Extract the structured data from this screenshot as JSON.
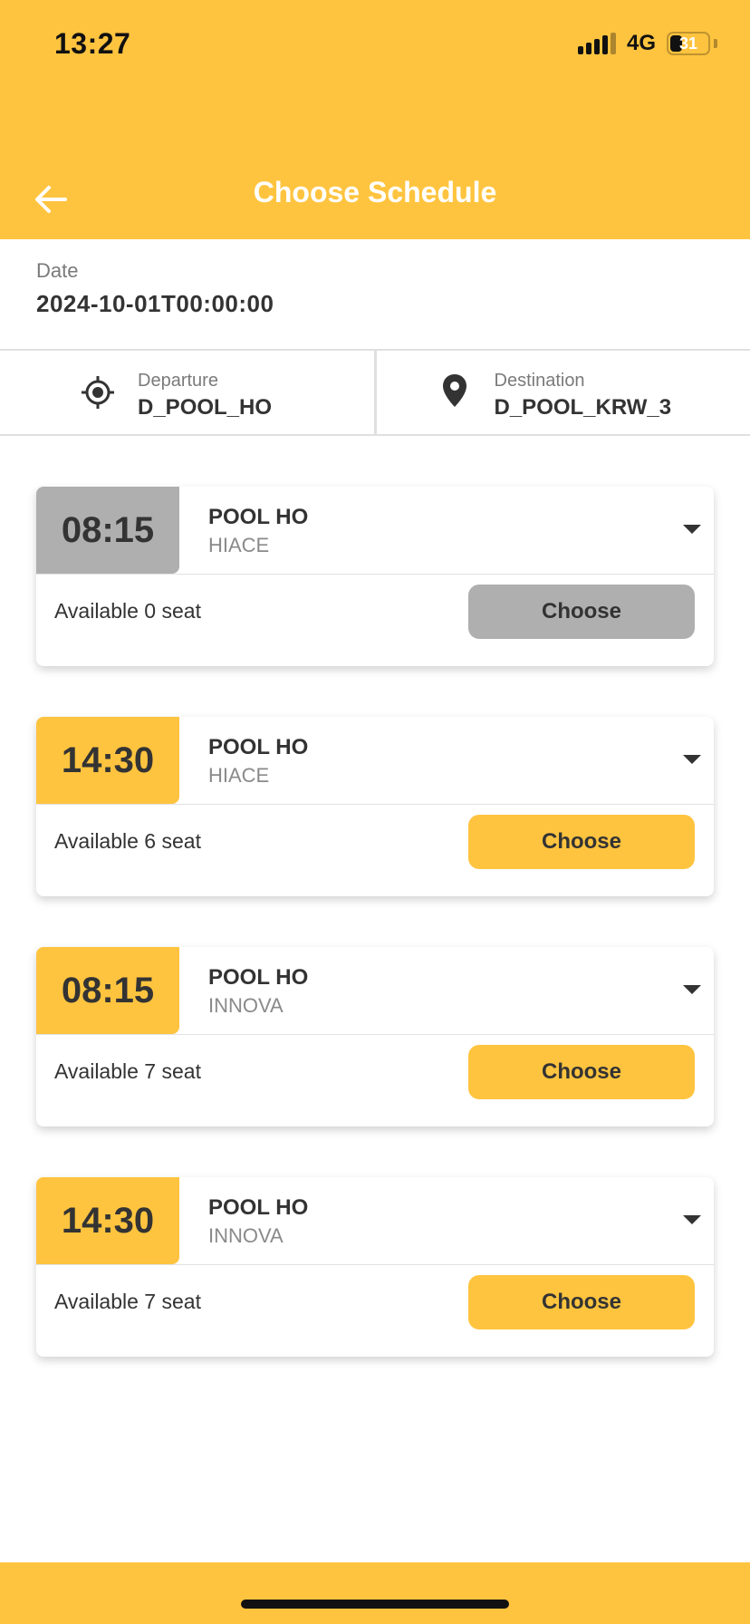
{
  "status_bar": {
    "time": "13:27",
    "network": "4G",
    "battery": "31"
  },
  "header": {
    "title": "Choose Schedule",
    "back_icon": "arrow-left-icon"
  },
  "date": {
    "label": "Date",
    "value": "2024-10-01T00:00:00"
  },
  "route": {
    "departure": {
      "label": "Departure",
      "value": "D_POOL_HO",
      "icon": "crosshair-icon"
    },
    "destination": {
      "label": "Destination",
      "value": "D_POOL_KRW_3",
      "icon": "map-pin-icon"
    }
  },
  "schedules": [
    {
      "time": "08:15",
      "pool": "POOL HO",
      "vehicle": "HIACE",
      "seats": "Available 0 seat",
      "button": "Choose",
      "available": false
    },
    {
      "time": "14:30",
      "pool": "POOL HO",
      "vehicle": "HIACE",
      "seats": "Available 6 seat",
      "button": "Choose",
      "available": true
    },
    {
      "time": "08:15",
      "pool": "POOL HO",
      "vehicle": "INNOVA",
      "seats": "Available 7 seat",
      "button": "Choose",
      "available": true
    },
    {
      "time": "14:30",
      "pool": "POOL HO",
      "vehicle": "INNOVA",
      "seats": "Available 7 seat",
      "button": "Choose",
      "available": true
    }
  ],
  "colors": {
    "accent": "#FFC43F",
    "disabled": "#AFAFAF",
    "text": "#333333"
  }
}
